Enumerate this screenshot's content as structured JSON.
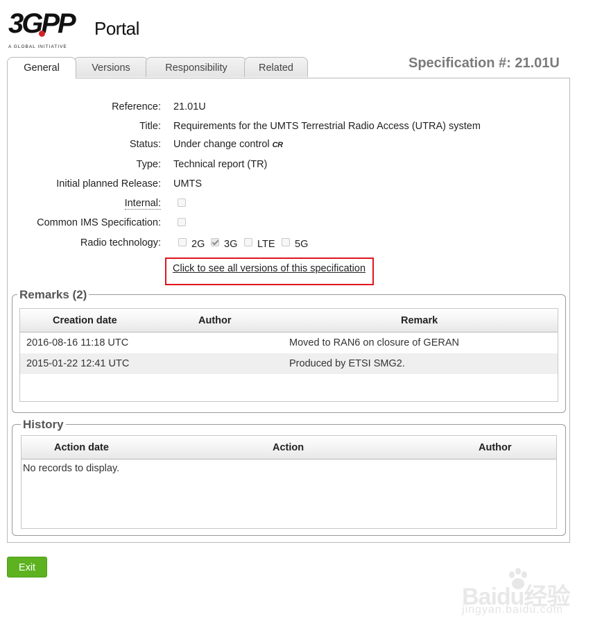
{
  "header": {
    "logo_text": "3GPP",
    "logo_tagline": "A GLOBAL INITIATIVE",
    "portal_text": "Portal"
  },
  "tabs": [
    {
      "label": "General",
      "active": true
    },
    {
      "label": "Versions",
      "active": false
    },
    {
      "label": "Responsibility",
      "active": false
    },
    {
      "label": "Related",
      "active": false
    }
  ],
  "spec_title": "Specification #: 21.01U",
  "fields": {
    "reference": {
      "label": "Reference:",
      "value": "21.01U"
    },
    "title": {
      "label": "Title:",
      "value": "Requirements for the UMTS Terrestrial Radio Access (UTRA) system"
    },
    "status": {
      "label": "Status:",
      "value": "Under change control",
      "badge": "CR"
    },
    "type": {
      "label": "Type:",
      "value": "Technical report (TR)"
    },
    "release": {
      "label": "Initial planned Release:",
      "value": "UMTS"
    },
    "internal": {
      "label": "Internal:",
      "checked": false
    },
    "common_ims": {
      "label": "Common IMS Specification:",
      "checked": false
    },
    "radio": {
      "label": "Radio technology:",
      "options": [
        {
          "label": "2G",
          "checked": false
        },
        {
          "label": "3G",
          "checked": true
        },
        {
          "label": "LTE",
          "checked": false
        },
        {
          "label": "5G",
          "checked": false
        }
      ]
    }
  },
  "versions_link": "Click to see all versions of this specification",
  "remarks": {
    "legend": "Remarks (2)",
    "columns": [
      "Creation date",
      "Author",
      "Remark"
    ],
    "rows": [
      {
        "date": "2016-08-16 11:18 UTC",
        "author": "",
        "remark": "Moved to RAN6 on closure of GERAN"
      },
      {
        "date": "2015-01-22 12:41 UTC",
        "author": "",
        "remark": "Produced by ETSI SMG2."
      }
    ]
  },
  "history": {
    "legend": "History",
    "columns": [
      "Action date",
      "Action",
      "Author"
    ],
    "empty_text": "No records to display."
  },
  "exit_label": "Exit",
  "watermark": {
    "top": "Baidu经验",
    "bottom": "jingyan.baidu.com"
  },
  "colors": {
    "accent_green": "#5cb21f",
    "highlight_red": "#e0141e",
    "spec_title_gray": "#7a7a7a"
  }
}
